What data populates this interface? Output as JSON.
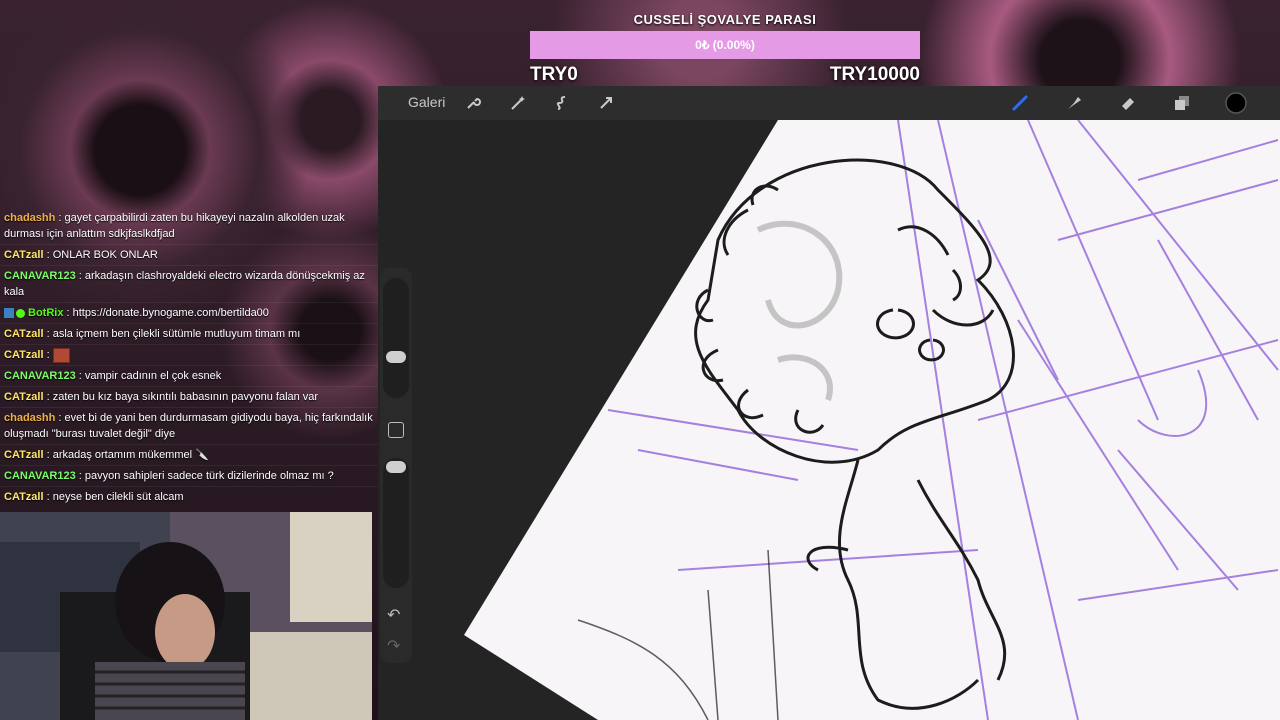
{
  "goal": {
    "title": "CUSSELİ ŞOVALYE PARASI",
    "progress_text": "0₺ (0.00%)",
    "start": "TRY0",
    "end": "TRY10000",
    "progress": 0
  },
  "app": {
    "gallery_label": "Galeri",
    "left_tools": [
      "wrench-icon",
      "magic-wand-icon",
      "selection-icon",
      "transform-icon"
    ],
    "right_tools": [
      "brush-icon",
      "smudge-icon",
      "eraser-icon",
      "layers-icon",
      "color-icon"
    ],
    "accent": "#2b6cf0",
    "undo": "↶",
    "redo": "↷"
  },
  "chat": [
    {
      "user": "chadashh",
      "color": "#f0b14a",
      "text": "gayet çarpabilirdi zaten bu hikayeyi nazalın alkolden uzak durması için anlattım sdkjfaslkdfjad"
    },
    {
      "user": "CATzall",
      "color": "#ffe66b",
      "text": "ONLAR BOK ONLAR"
    },
    {
      "user": "CANAVAR123",
      "color": "#7cfc6a",
      "text": "arkadaşın clashroyaldeki electro wizarda dönüşcekmiş az kala"
    },
    {
      "user": "BotRix",
      "color": "#53fc18",
      "text": "https://donate.bynogame.com/bertilda00",
      "bot": true
    },
    {
      "user": "CATzall",
      "color": "#ffe66b",
      "text": "asla içmem ben çilekli sütümle mutluyum timam mı"
    },
    {
      "user": "CATzall",
      "color": "#ffe66b",
      "text": "",
      "emote": true
    },
    {
      "user": "CANAVAR123",
      "color": "#7cfc6a",
      "text": "vampir cadının el çok esnek"
    },
    {
      "user": "CATzall",
      "color": "#ffe66b",
      "text": "zaten bu kız baya sıkıntılı babasının pavyonu falan var"
    },
    {
      "user": "chadashh",
      "color": "#f0b14a",
      "text": "evet bi de yani ben durdurmasam gidiyodu baya, hiç farkındalık oluşmadı \"burası tuvalet değil\" diye"
    },
    {
      "user": "CATzall",
      "color": "#ffe66b",
      "text": "arkadaş ortamım mükemmel 🔪"
    },
    {
      "user": "CANAVAR123",
      "color": "#7cfc6a",
      "text": "pavyon sahipleri sadece türk dizilerinde olmaz mı ?"
    },
    {
      "user": "CATzall",
      "color": "#ffe66b",
      "text": "neyse ben cilekli süt alcam"
    }
  ]
}
